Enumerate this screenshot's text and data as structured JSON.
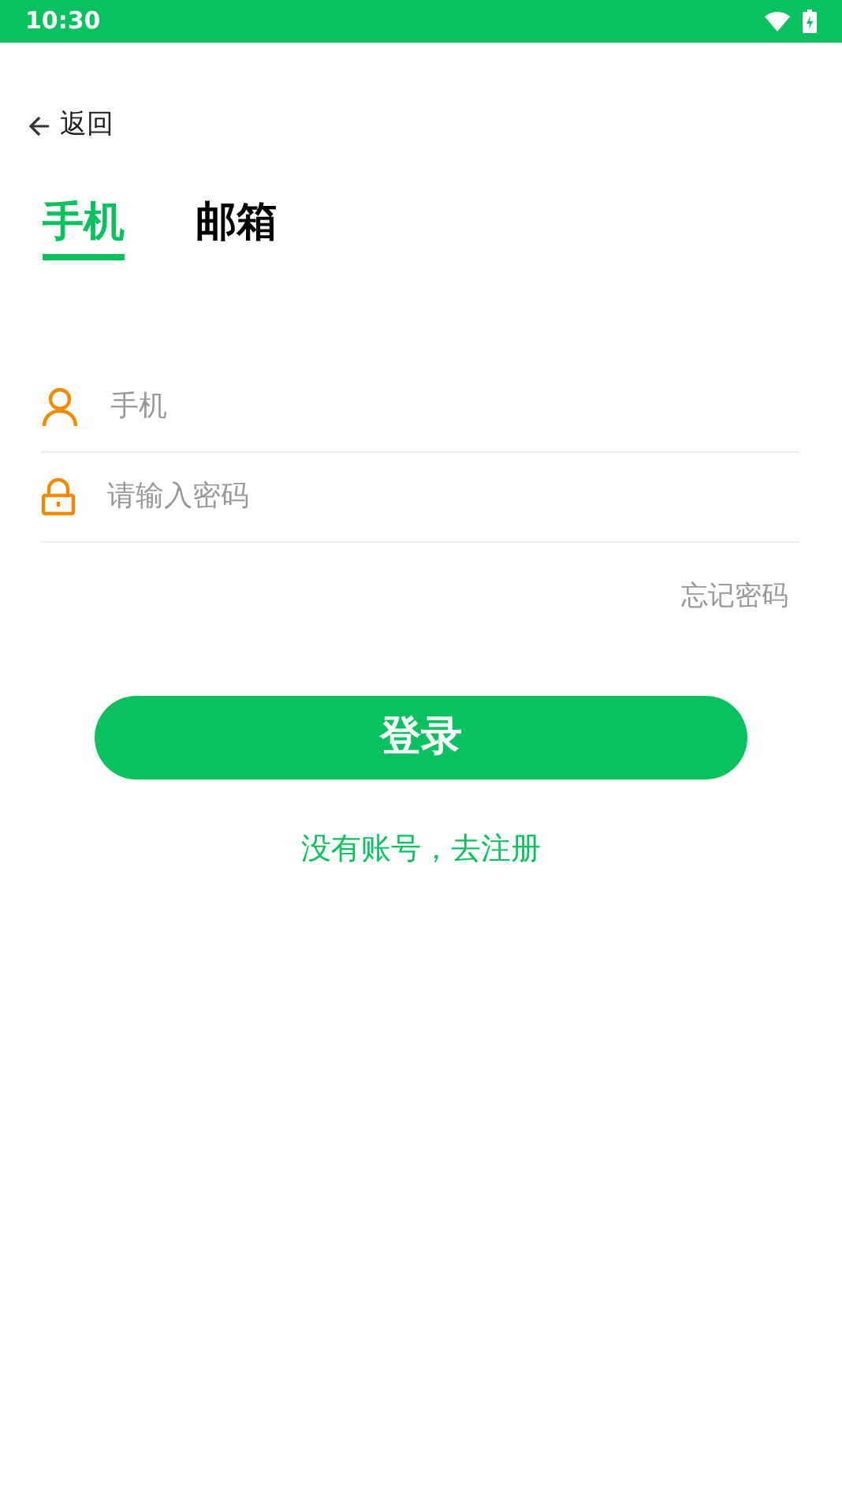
{
  "status_bar": {
    "time": "10:30"
  },
  "back": {
    "label": "返回"
  },
  "tabs": [
    {
      "label": "手机",
      "selected": true
    },
    {
      "label": "邮箱",
      "selected": false
    }
  ],
  "fields": [
    {
      "kind": "user",
      "placeholder": "手机"
    },
    {
      "kind": "lock",
      "placeholder": "请输入密码"
    }
  ],
  "forgot_link": "忘记密码",
  "login_button": "登录",
  "register_link": "没有账号，去注册"
}
